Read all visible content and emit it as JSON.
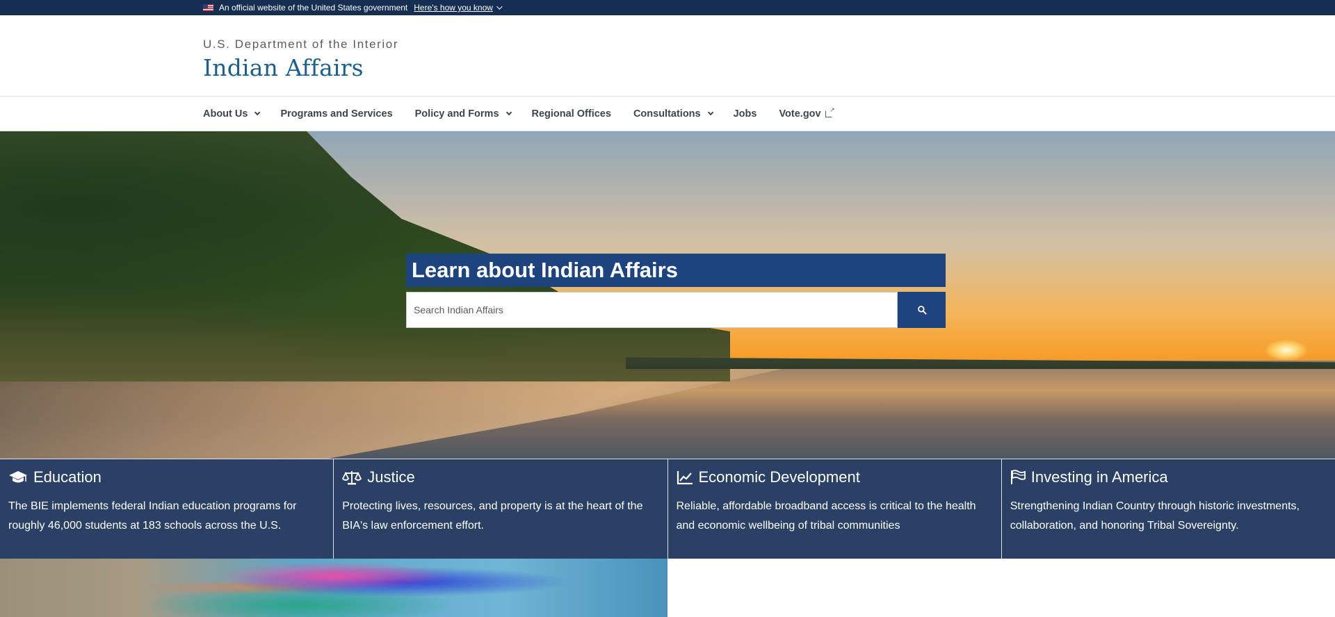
{
  "gov_banner": {
    "text": "An official website of the United States government",
    "link": "Here's how you know"
  },
  "header": {
    "department": "U.S. Department of the Interior",
    "title": "Indian Affairs"
  },
  "nav": {
    "items": [
      {
        "label": "About Us",
        "dropdown": true
      },
      {
        "label": "Programs and Services",
        "dropdown": false
      },
      {
        "label": "Policy and Forms",
        "dropdown": true
      },
      {
        "label": "Regional Offices",
        "dropdown": false
      },
      {
        "label": "Consultations",
        "dropdown": true
      },
      {
        "label": "Jobs",
        "dropdown": false
      },
      {
        "label": "Vote.gov",
        "dropdown": false,
        "external": true
      }
    ]
  },
  "hero": {
    "title": "Learn about Indian Affairs",
    "search_placeholder": "Search Indian Affairs",
    "search_icon": "search-icon"
  },
  "cards": [
    {
      "icon": "graduation-cap-icon",
      "title": "Education",
      "text": "The BIE implements federal Indian education programs for roughly 46,000 students at 183 schools across the U.S."
    },
    {
      "icon": "balance-scale-icon",
      "title": "Justice",
      "text": "Protecting lives, resources, and property is at the heart of the BIA's law enforcement effort."
    },
    {
      "icon": "line-chart-icon",
      "title": "Economic Development",
      "text": "Reliable, affordable broadband access is critical to the health and economic wellbeing of tribal communities"
    },
    {
      "icon": "flag-icon",
      "title": "Investing in America",
      "text": "Strengthening Indian Country through historic investments, collaboration, and honoring Tribal Sovereignty."
    }
  ],
  "colors": {
    "gov_banner_bg": "#162e51",
    "title_blue": "#1a5f8f",
    "search_blue": "#1e4480",
    "card_bg": "#2a4165"
  }
}
